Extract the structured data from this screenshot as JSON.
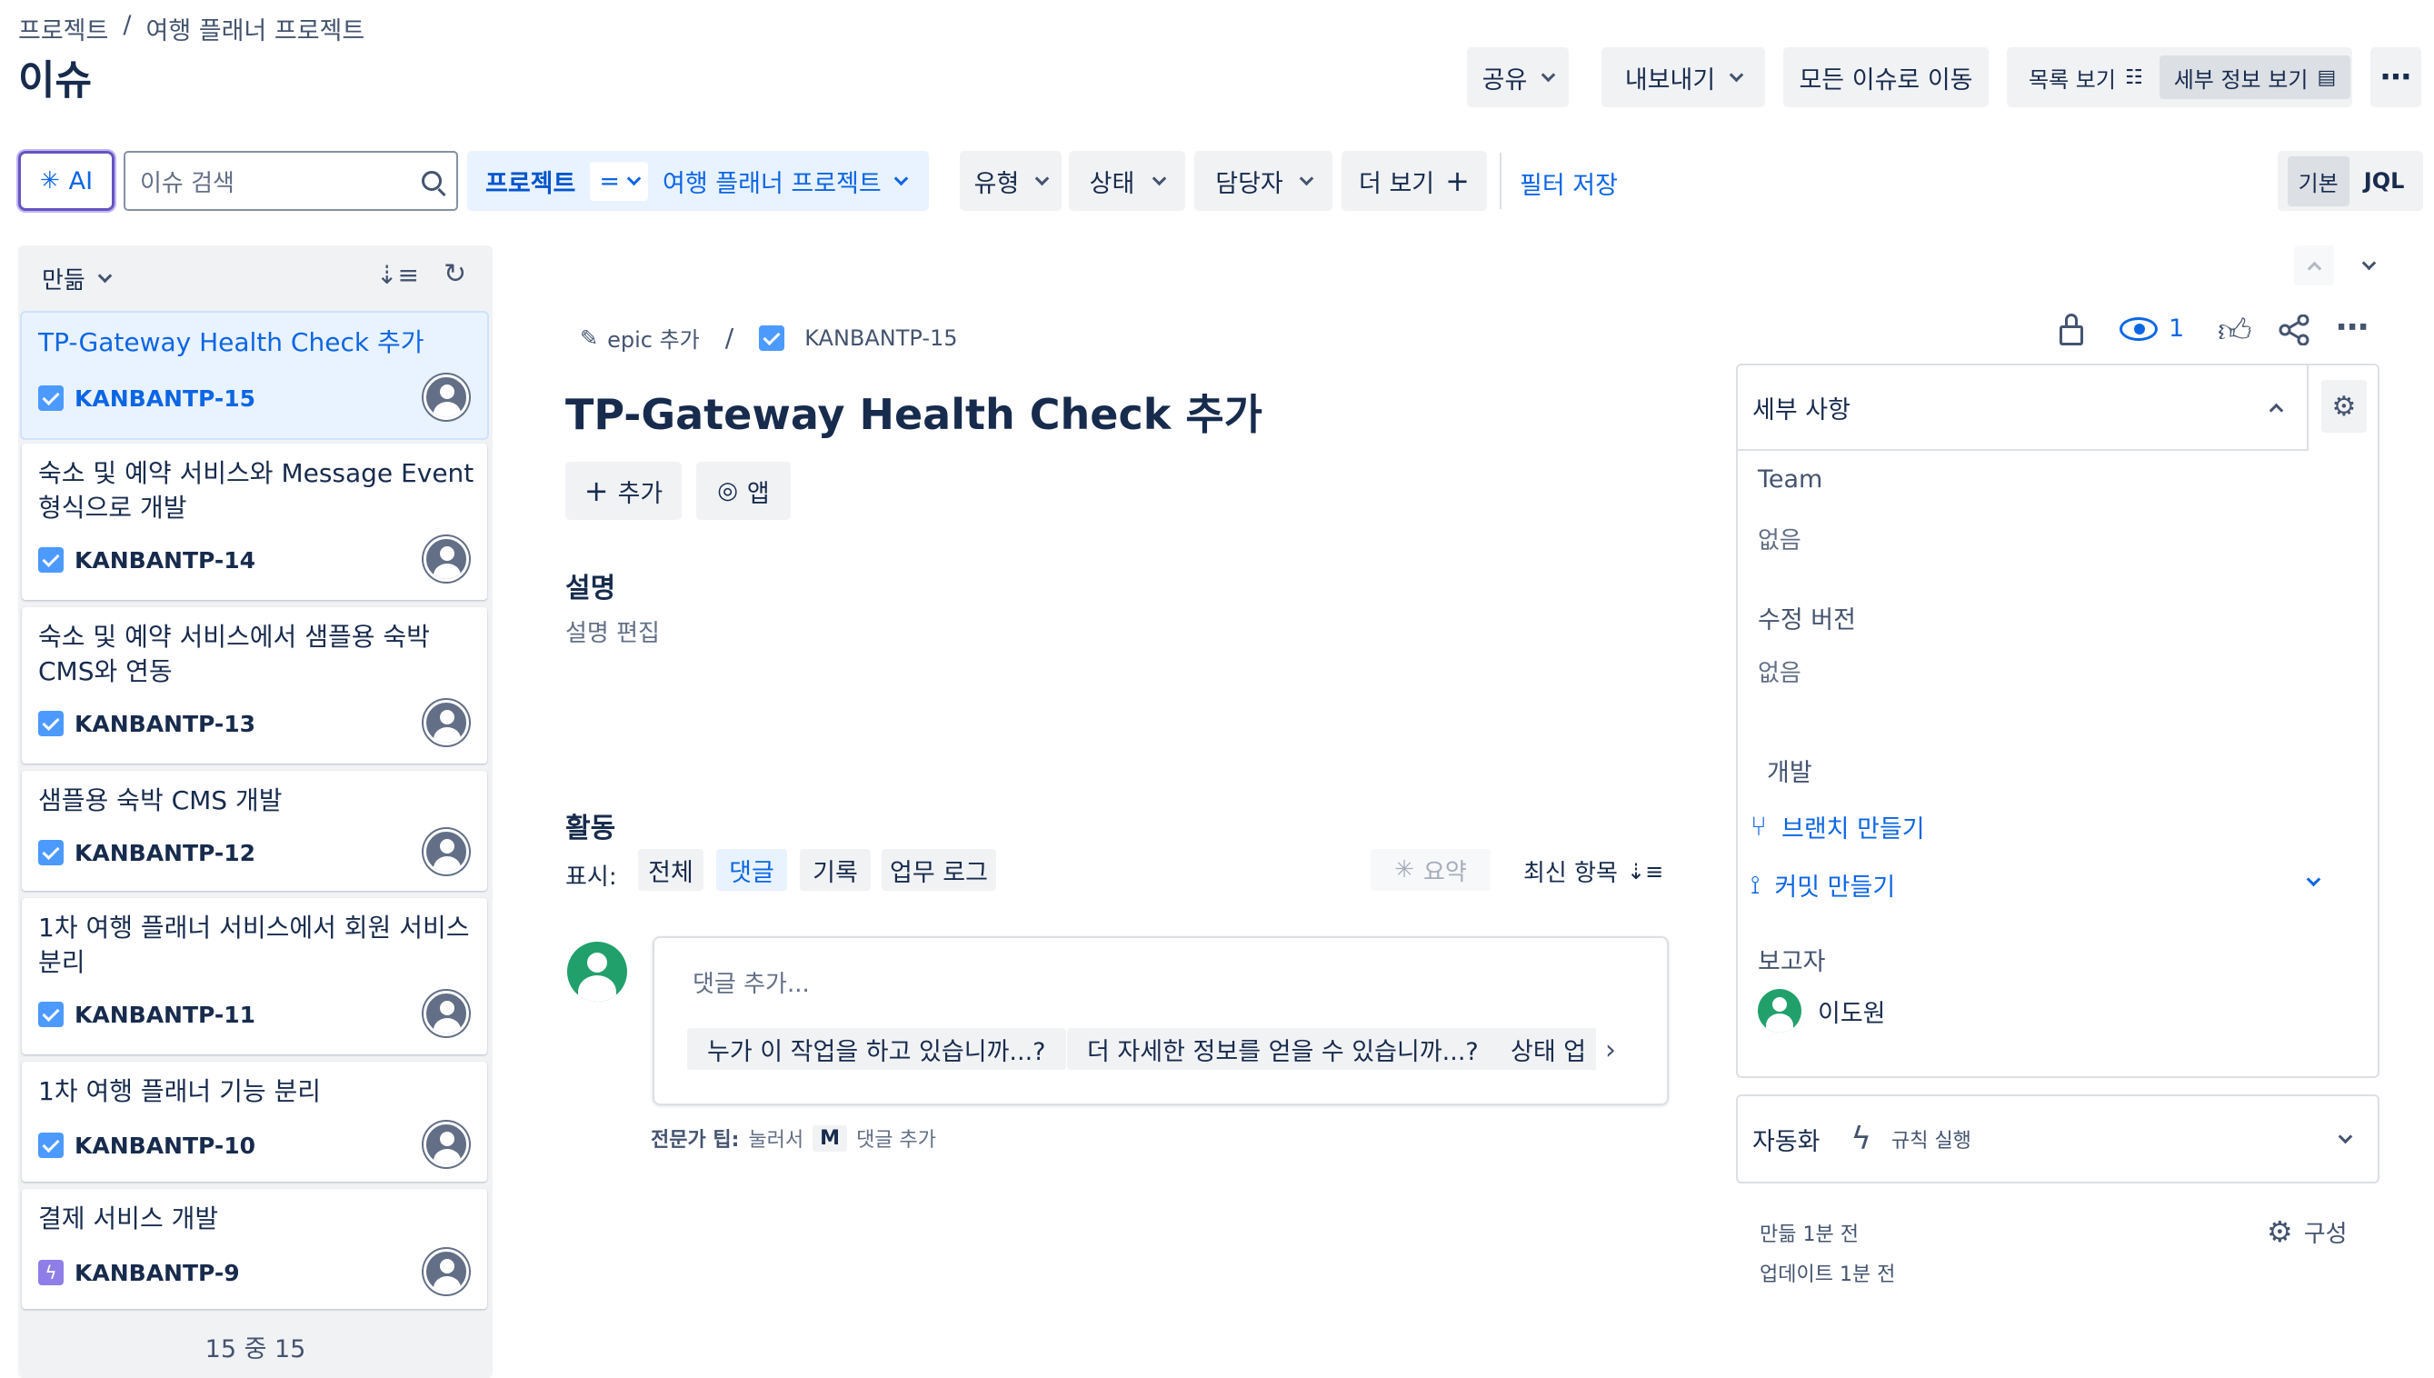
{
  "breadcrumb": {
    "project": "프로젝트",
    "separator": "/",
    "name": "여행 플래너 프로젝트"
  },
  "page_title": "이슈",
  "header_actions": {
    "share": "공유",
    "export": "내보내기",
    "go_all": "모든 이슈로 이동",
    "list_view": "목록 보기",
    "detail_view": "세부 정보 보기"
  },
  "filters": {
    "ai_label": "AI",
    "search_placeholder": "이슈 검색",
    "project_label": "프로젝트",
    "project_op": "=",
    "project_value": "여행 플래너 프로젝트",
    "type": "유형",
    "status": "상태",
    "assignee": "담당자",
    "more": "더 보기",
    "save_filter": "필터 저장",
    "basic": "기본",
    "jql": "JQL"
  },
  "list": {
    "sort_label": "만듦",
    "count": "15 중 15",
    "items": [
      {
        "title": "TP-Gateway Health Check 추가",
        "key": "KANBANTP-15",
        "type": "task"
      },
      {
        "title": "숙소 및 예약 서비스와 Message Event 형식으로 개발",
        "key": "KANBANTP-14",
        "type": "task"
      },
      {
        "title": "숙소 및 예약 서비스에서 샘플용 숙박 CMS와 연동",
        "key": "KANBANTP-13",
        "type": "task"
      },
      {
        "title": "샘플용 숙박 CMS 개발",
        "key": "KANBANTP-12",
        "type": "task"
      },
      {
        "title": "1차 여행 플래너 서비스에서 회원 서비스 분리",
        "key": "KANBANTP-11",
        "type": "task"
      },
      {
        "title": "1차 여행 플래너 기능 분리",
        "key": "KANBANTP-10",
        "type": "task"
      },
      {
        "title": "결제 서비스 개발",
        "key": "KANBANTP-9",
        "type": "epic"
      }
    ]
  },
  "issue": {
    "epic_add": "epic 추가",
    "separator": "/",
    "key": "KANBANTP-15",
    "watchers": "1",
    "title": "TP-Gateway Health Check 추가",
    "add_button": "추가",
    "apps_button": "앱",
    "description_heading": "설명",
    "description_placeholder": "설명 편집",
    "activity_heading": "활동",
    "show_label": "표시:",
    "activity_tabs": [
      "전체",
      "댓글",
      "기록",
      "업무 로그"
    ],
    "summary": "요약",
    "newest": "최신 항목",
    "comment_placeholder": "댓글 추가...",
    "suggestions": [
      "누가 이 작업을 하고 있습니까...?",
      "더 자세한 정보를 얻을 수 있습니까...?",
      "상태 업"
    ],
    "pro_tip_bold": "전문가 팁:",
    "pro_tip_press": "눌러서",
    "pro_tip_key": "M",
    "pro_tip_action": "댓글 추가"
  },
  "details": {
    "heading": "세부 사항",
    "team_label": "Team",
    "team_value": "없음",
    "fix_version_label": "수정 버전",
    "fix_version_value": "없음",
    "development_label": "개발",
    "create_branch": "브랜치 만들기",
    "create_commit": "커밋 만들기",
    "reporter_label": "보고자",
    "reporter_name": "이도원",
    "automation_label": "자동화",
    "automation_run": "규칙 실행",
    "created": "만듦 1분 전",
    "updated": "업데이트 1분 전",
    "configure": "구성"
  },
  "colors": {
    "link_blue": "#0c66e4",
    "selected_bg": "#e9f2ff",
    "gray_bg": "#f1f2f4",
    "task_blue": "#4c9aff",
    "epic_purple": "#8f7ee7",
    "avatar_green": "#22a06b"
  }
}
